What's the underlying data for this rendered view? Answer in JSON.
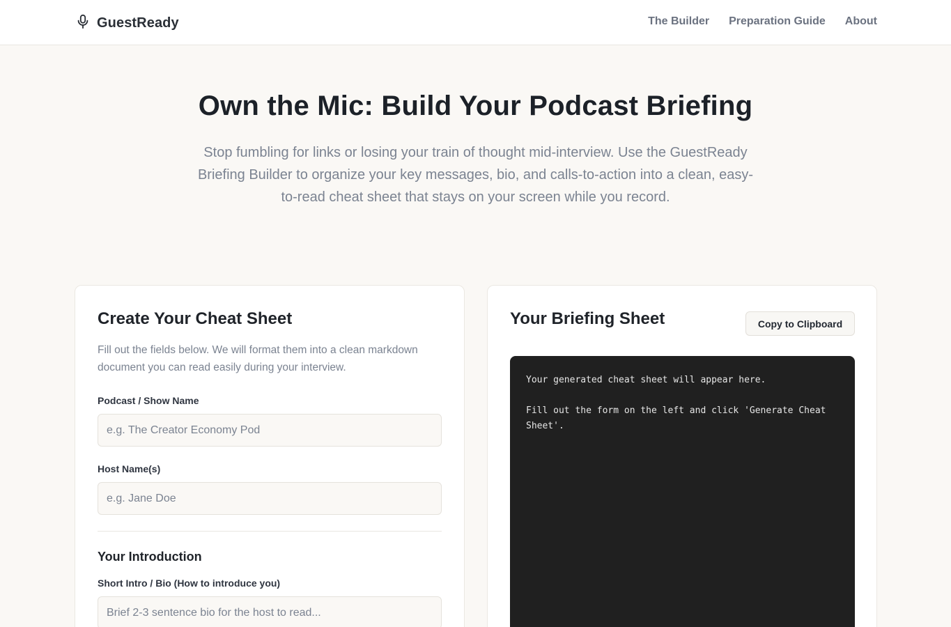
{
  "header": {
    "brand": "GuestReady",
    "brand_icon": "microphone-icon",
    "nav": [
      "The Builder",
      "Preparation Guide",
      "About"
    ]
  },
  "hero": {
    "title": "Own the Mic: Build Your Podcast Briefing",
    "subtitle": "Stop fumbling for links or losing your train of thought mid-interview. Use the GuestReady Briefing Builder to organize your key messages, bio, and calls-to-action into a clean, easy-to-read cheat sheet that stays on your screen while you record."
  },
  "form": {
    "title": "Create Your Cheat Sheet",
    "description": "Fill out the fields below. We will format them into a clean markdown document you can read easily during your interview.",
    "podcast_label": "Podcast / Show Name",
    "podcast_placeholder": "e.g. The Creator Economy Pod",
    "host_label": "Host Name(s)",
    "host_placeholder": "e.g. Jane Doe",
    "intro_section": "Your Introduction",
    "bio_label": "Short Intro / Bio (How to introduce you)",
    "bio_placeholder": "Brief 2-3 sentence bio for the host to read..."
  },
  "briefing": {
    "title": "Your Briefing Sheet",
    "copy_button": "Copy to Clipboard",
    "output_text": "Your generated cheat sheet will appear here.\n\nFill out the form on the left and click 'Generate Cheat Sheet'."
  },
  "colors": {
    "page_bg": "#faf8f5",
    "output_bg": "#202020",
    "muted_text": "#7b8391"
  }
}
